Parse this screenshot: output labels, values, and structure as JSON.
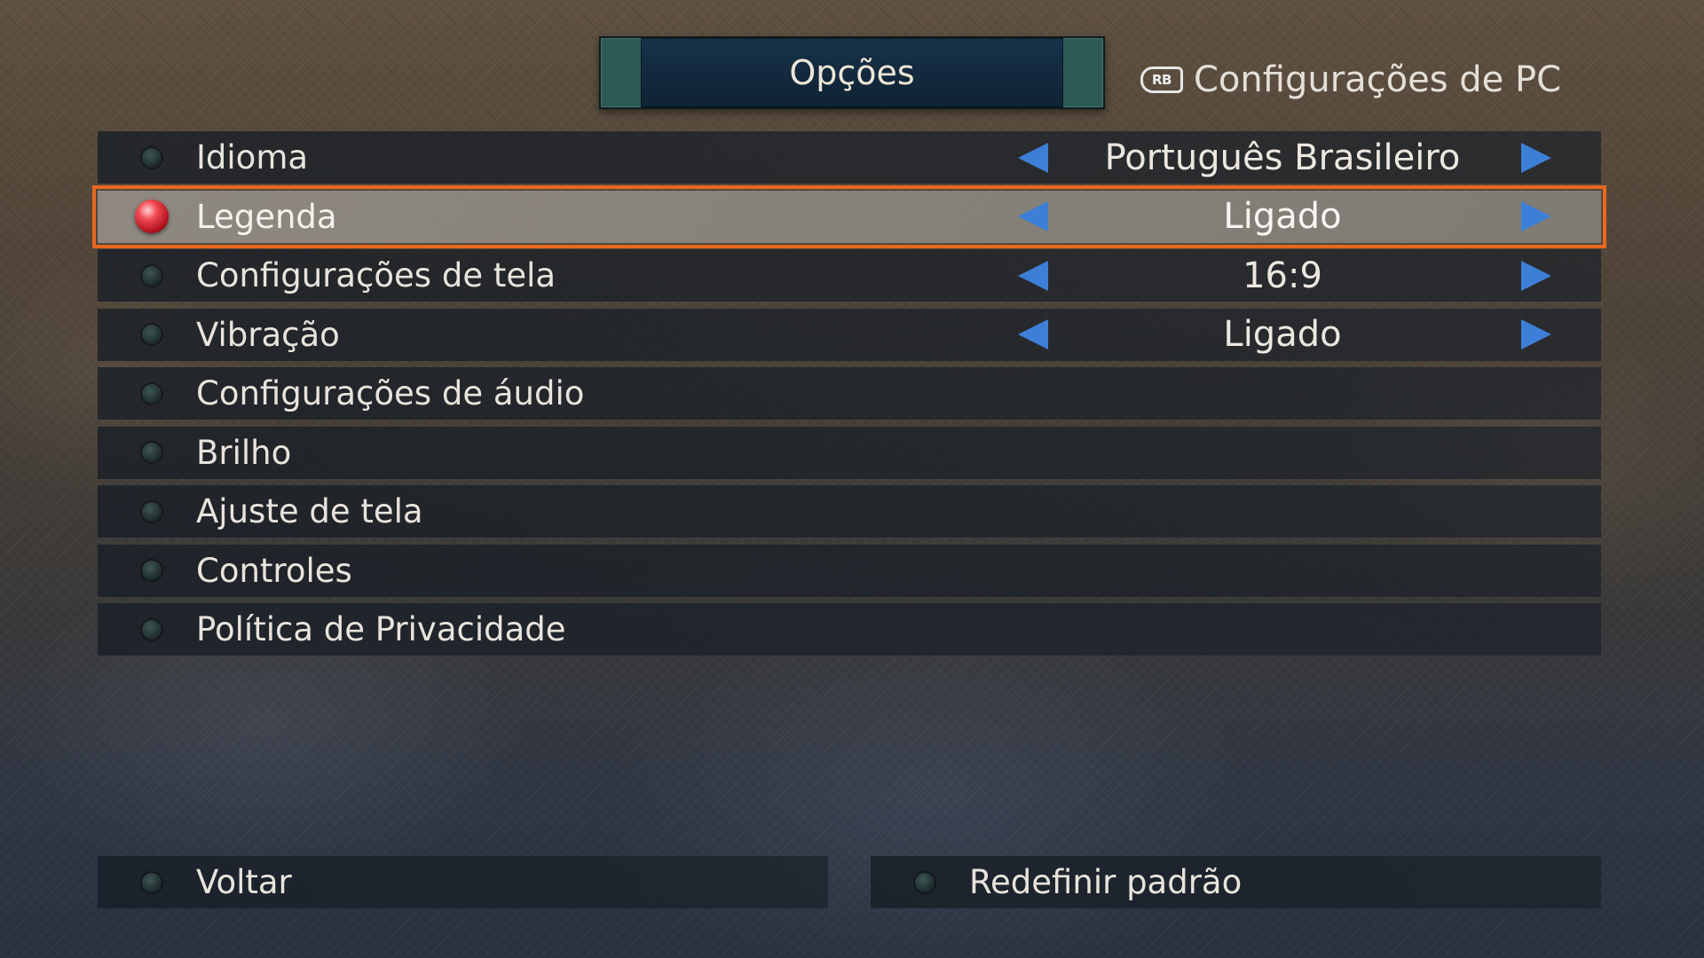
{
  "header": {
    "active_tab": "Opções",
    "secondary_tab_button": "RB",
    "secondary_tab": "Configurações de PC"
  },
  "options": [
    {
      "label": "Idioma",
      "value": "Português Brasileiro",
      "selected": false
    },
    {
      "label": "Legenda",
      "value": "Ligado",
      "selected": true
    },
    {
      "label": "Configurações de tela",
      "value": "16:9",
      "selected": false
    },
    {
      "label": "Vibração",
      "value": "Ligado",
      "selected": false
    },
    {
      "label": "Configurações de áudio",
      "value": null,
      "selected": false
    },
    {
      "label": "Brilho",
      "value": null,
      "selected": false
    },
    {
      "label": "Ajuste de tela",
      "value": null,
      "selected": false
    },
    {
      "label": "Controles",
      "value": null,
      "selected": false
    },
    {
      "label": "Política de Privacidade",
      "value": null,
      "selected": false
    }
  ],
  "footer": {
    "back_label": "Voltar",
    "reset_label": "Redefinir padrão"
  },
  "colors": {
    "selection_outline": "#e8671f",
    "arrow": "#3d7fd6",
    "selected_bullet": "#d0202c"
  }
}
